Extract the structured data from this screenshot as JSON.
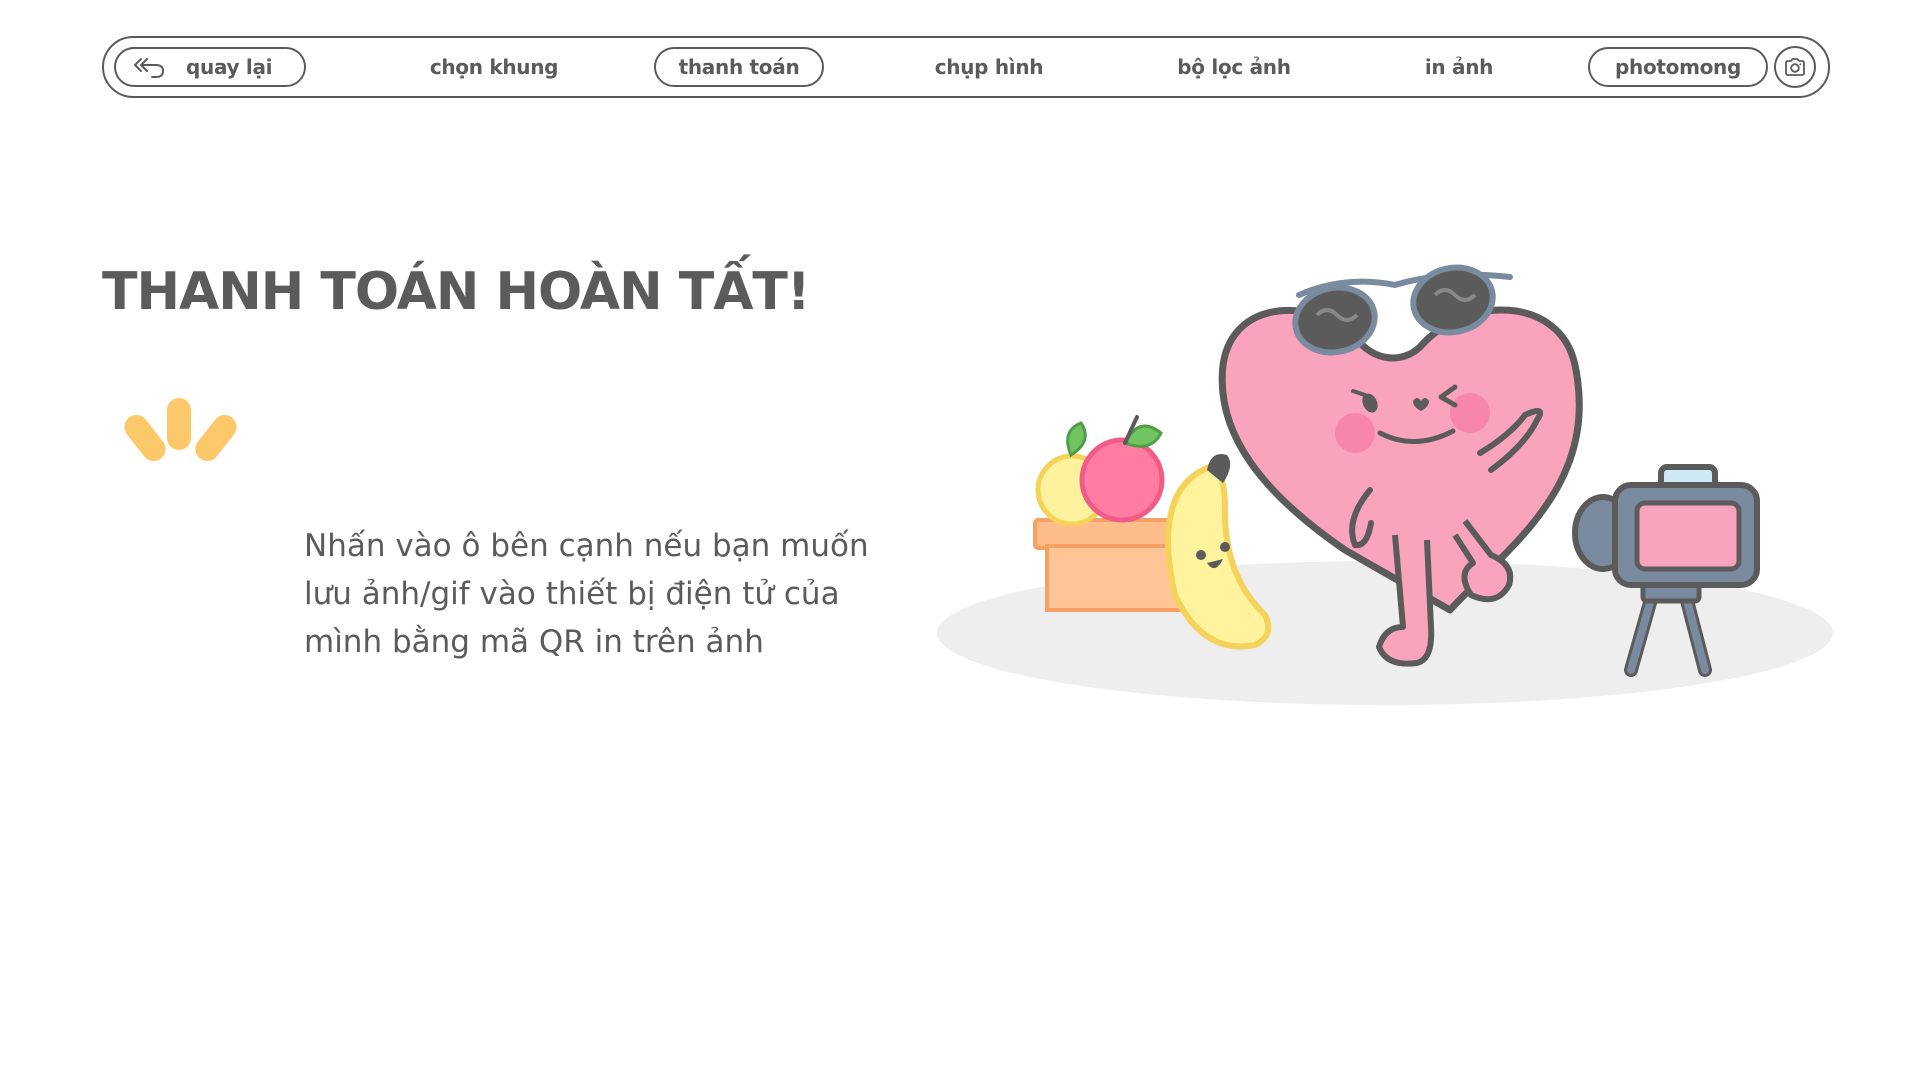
{
  "nav": {
    "back_label": "quay lại",
    "items": [
      {
        "label": "chọn khung"
      },
      {
        "label": "thanh toán",
        "active": true
      },
      {
        "label": "chụp hình"
      },
      {
        "label": "bộ lọc ảnh"
      },
      {
        "label": "in ảnh"
      }
    ],
    "brand_label": "photomong",
    "back_icon": "undo-arrow-icon",
    "camera_icon": "camera-icon"
  },
  "main": {
    "title": "THANH TOÁN HOÀN TẤT!",
    "description": "Nhấn vào ô bên cạnh nếu bạn muốn lưu ảnh/gif vào thiết bị điện tử của mình bằng mã QR in trên ảnh",
    "sparkle_icon": "sparkle-accent-icon",
    "illustration": "heart-mascot-with-sunglasses-fruits-and-camera"
  },
  "colors": {
    "text": "#5b5b5b",
    "accent_yellow": "#fcc96a",
    "heart_pink": "#f9a3bd",
    "ground_gray": "#eeeeee"
  }
}
